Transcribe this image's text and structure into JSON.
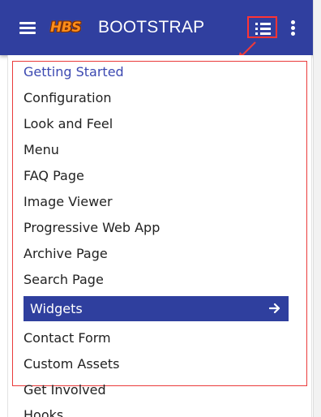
{
  "header": {
    "brand": "BOOTSTRAP",
    "logo_text": "HBS",
    "icons": {
      "menu": "hamburger-menu-icon",
      "toc": "list-toc-icon",
      "more": "more-vertical-icon"
    },
    "colors": {
      "appbar": "#303f9f",
      "accent_highlight": "#ff3434"
    }
  },
  "menu": {
    "items": [
      {
        "label": "Getting Started",
        "state": "current"
      },
      {
        "label": "Configuration"
      },
      {
        "label": "Look and Feel"
      },
      {
        "label": "Menu"
      },
      {
        "label": "FAQ Page"
      },
      {
        "label": "Image Viewer"
      },
      {
        "label": "Progressive Web App"
      },
      {
        "label": "Archive Page"
      },
      {
        "label": "Search Page"
      },
      {
        "label": "Widgets",
        "state": "active",
        "icon": "arrow-right-icon"
      },
      {
        "label": "Contact Form"
      },
      {
        "label": "Custom Assets"
      },
      {
        "label": "Get Involved"
      },
      {
        "label": "Hooks"
      }
    ],
    "colors": {
      "current_text": "#3b48b1",
      "active_background": "#2f3f9e",
      "active_text": "#ffffff",
      "default_text": "#222222"
    }
  }
}
